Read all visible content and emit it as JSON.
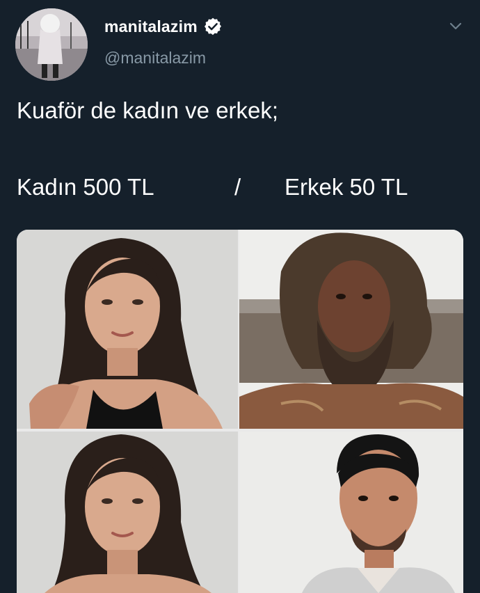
{
  "tweet": {
    "display_name": "manitalazim",
    "handle": "@manitalazim",
    "text_line1": "Kuaför de kadın ve erkek;",
    "kadin_price": "Kadın 500 TL",
    "separator": "/",
    "erkek_price": "Erkek 50 TL"
  },
  "icons": {
    "verified": "verified-badge-icon",
    "menu": "chevron-down-icon"
  },
  "colors": {
    "background": "#15202b",
    "text_primary": "#ffffff",
    "text_secondary": "#8899a6"
  }
}
